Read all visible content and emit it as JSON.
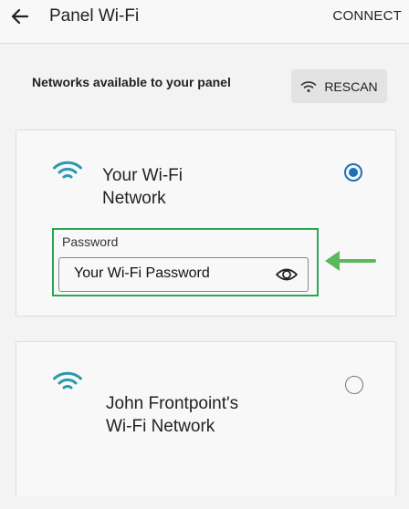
{
  "header": {
    "title": "Panel Wi-Fi",
    "connect_label": "CONNECT",
    "back_icon": "arrow-left-icon"
  },
  "main": {
    "section_label": "Networks available to your panel",
    "rescan": {
      "label": "RESCAN",
      "icon": "wifi-icon"
    }
  },
  "networks": [
    {
      "name_line1": "Your Wi-Fi",
      "name_line2": "Network",
      "selected": true,
      "password": {
        "label": "Password",
        "value": "Your Wi-Fi Password",
        "toggle_icon": "eye-icon"
      }
    },
    {
      "name_line1": "John Frontpoint's",
      "name_line2": "Wi-Fi Network",
      "selected": false
    }
  ],
  "colors": {
    "wifi_icon": "#2a9aae",
    "radio_selected": "#1f6fb8",
    "highlight": "#2aa657",
    "arrow": "#5cb85c"
  }
}
